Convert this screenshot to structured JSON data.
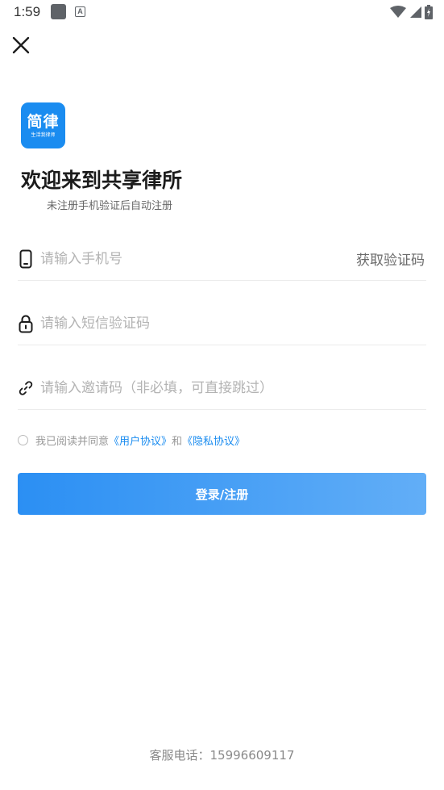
{
  "status_bar": {
    "time": "1:59",
    "a_icon_label": "A",
    "icons": [
      "app-icon",
      "text-a-icon",
      "wifi-icon",
      "signal-icon",
      "battery-charging-icon"
    ]
  },
  "header": {
    "close_icon": "close-icon"
  },
  "logo": {
    "main": "简律",
    "sub": "生活我律师"
  },
  "title": "欢迎来到共享律所",
  "subtitle": "未注册手机验证后自动注册",
  "form": {
    "phone": {
      "placeholder": "请输入手机号",
      "value": "",
      "icon": "phone-icon"
    },
    "get_code_label": "获取验证码",
    "sms_code": {
      "placeholder": "请输入短信验证码",
      "value": "",
      "icon": "lock-icon"
    },
    "invite": {
      "placeholder": "请输入邀请码（非必填，可直接跳过）",
      "value": "",
      "icon": "link-icon"
    }
  },
  "agreement": {
    "checked": false,
    "prefix": "我已阅读并同意",
    "user_agreement": "《用户协议》",
    "and": "和",
    "privacy_agreement": "《隐私协议》"
  },
  "login_button_label": "登录/注册",
  "footer": "客服电话：15996609117",
  "colors": {
    "brand": "#1a8cf0",
    "button_start": "#2b8ff3",
    "button_end": "#62aef7"
  }
}
